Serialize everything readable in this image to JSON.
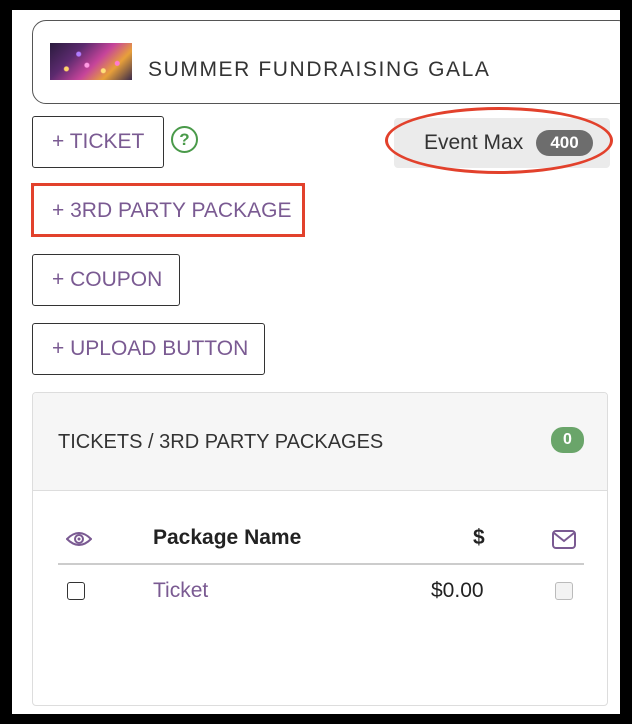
{
  "event": {
    "title": "SUMMER FUNDRAISING GALA"
  },
  "actions": {
    "ticket": "+ TICKET",
    "third_party_package": "+ 3RD PARTY PACKAGE",
    "coupon": "+ COUPON",
    "upload_button": "+ UPLOAD BUTTON",
    "help_glyph": "?"
  },
  "event_max": {
    "label": "Event Max",
    "value": "400"
  },
  "panel": {
    "title": "TICKETS / 3RD PARTY PACKAGES",
    "count": "0",
    "columns": {
      "visibility_icon": "eye-icon",
      "name": "Package Name",
      "price": "$",
      "email_icon": "envelope-icon"
    },
    "rows": [
      {
        "name": "Ticket",
        "price": "$0.00",
        "visible_checked": false,
        "email_checked": false
      }
    ]
  },
  "colors": {
    "accent_purple": "#7a5a92",
    "success_green": "#6aa56a",
    "annotation_red": "#e2412c",
    "badge_gray": "#6d6d6d"
  }
}
